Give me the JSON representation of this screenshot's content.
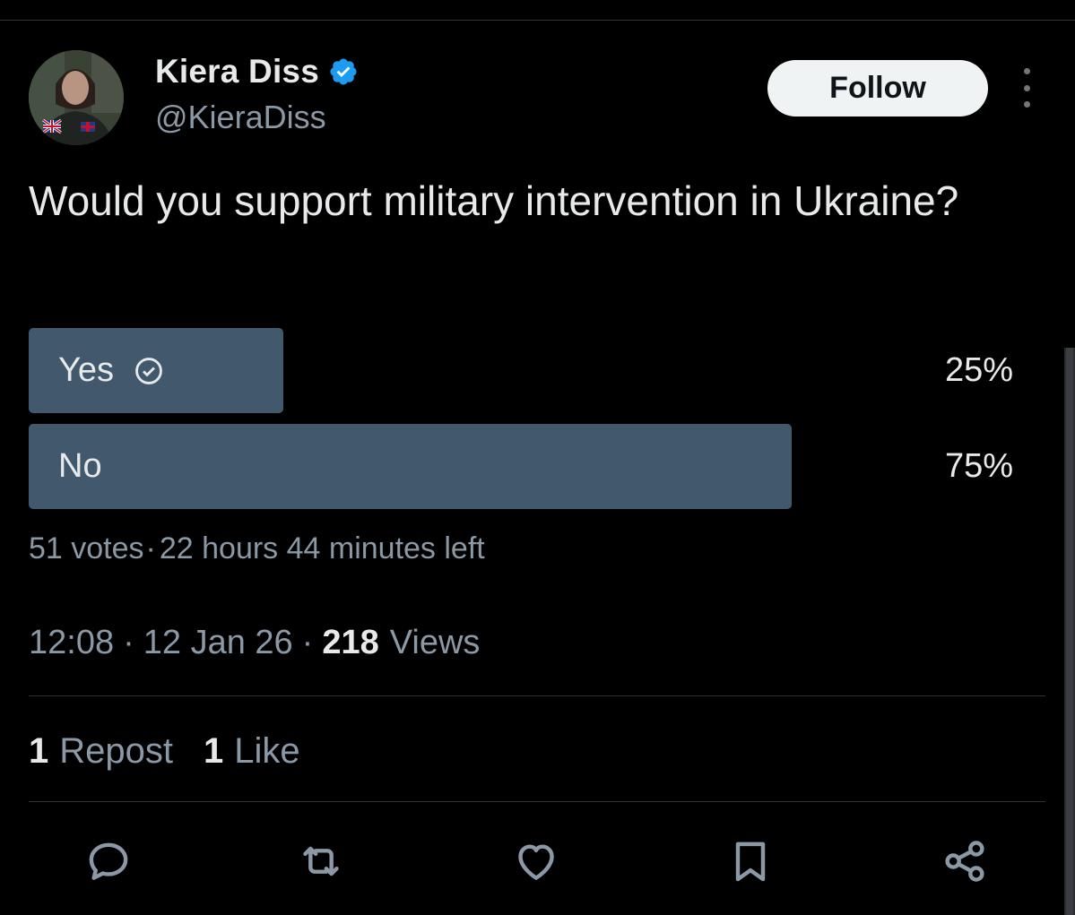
{
  "user": {
    "display_name": "Kiera Diss",
    "handle": "@KieraDiss",
    "verified": true,
    "verified_color": "#1d9bf0"
  },
  "header": {
    "follow_label": "Follow"
  },
  "tweet": {
    "text": "Would you support military intervention in Ukraine?"
  },
  "poll": {
    "options": [
      {
        "label": "Yes",
        "percent_label": "25%",
        "percent": 25,
        "selected": true
      },
      {
        "label": "No",
        "percent_label": "75%",
        "percent": 75,
        "selected": false
      }
    ],
    "meta": {
      "votes": "51 votes",
      "separator": "·",
      "time_left": "22 hours 44 minutes left"
    },
    "fill_color": "#42596d"
  },
  "timestamp": {
    "time": "12:08",
    "date": "12 Jan 26",
    "separator": "·",
    "views_count": "218",
    "views_label": "Views"
  },
  "stats": {
    "reposts_count": "1",
    "reposts_label": "Repost",
    "likes_count": "1",
    "likes_label": "Like"
  },
  "actions": [
    {
      "icon": "reply-icon"
    },
    {
      "icon": "repost-icon"
    },
    {
      "icon": "like-icon"
    },
    {
      "icon": "bookmark-icon"
    },
    {
      "icon": "share-icon"
    }
  ],
  "colors": {
    "background": "#000000",
    "text_primary": "#e7e9ea",
    "text_secondary": "#8b98a5",
    "divider": "#2f3336"
  }
}
